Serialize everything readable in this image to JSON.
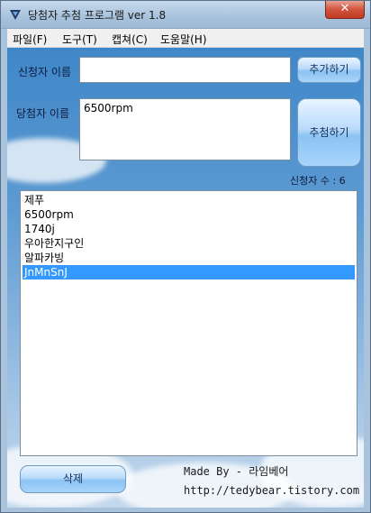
{
  "window": {
    "title": "당첨자 추첨 프로그램 ver 1.8",
    "close_label": "✕"
  },
  "menu": [
    {
      "label": "파일(F)"
    },
    {
      "label": "도구(T)"
    },
    {
      "label": "캡쳐(C)"
    },
    {
      "label": "도움말(H)"
    }
  ],
  "form": {
    "applicant_label": "신청자 이름",
    "applicant_value": "",
    "add_button": "추가하기",
    "winner_label": "당첨자 이름",
    "winner_value": "6500rpm",
    "draw_button": "추첨하기",
    "count_text": "신청자 수 : 6"
  },
  "list": {
    "items": [
      "제푸",
      "6500rpm",
      "1740j",
      "우아한지구인",
      "알파카빙",
      "JnMnSnJ"
    ],
    "selected_index": 5
  },
  "footer": {
    "delete_button": "삭제",
    "made_by": "Made By - 라임베어",
    "url": "http://tedybear.tistory.com"
  }
}
